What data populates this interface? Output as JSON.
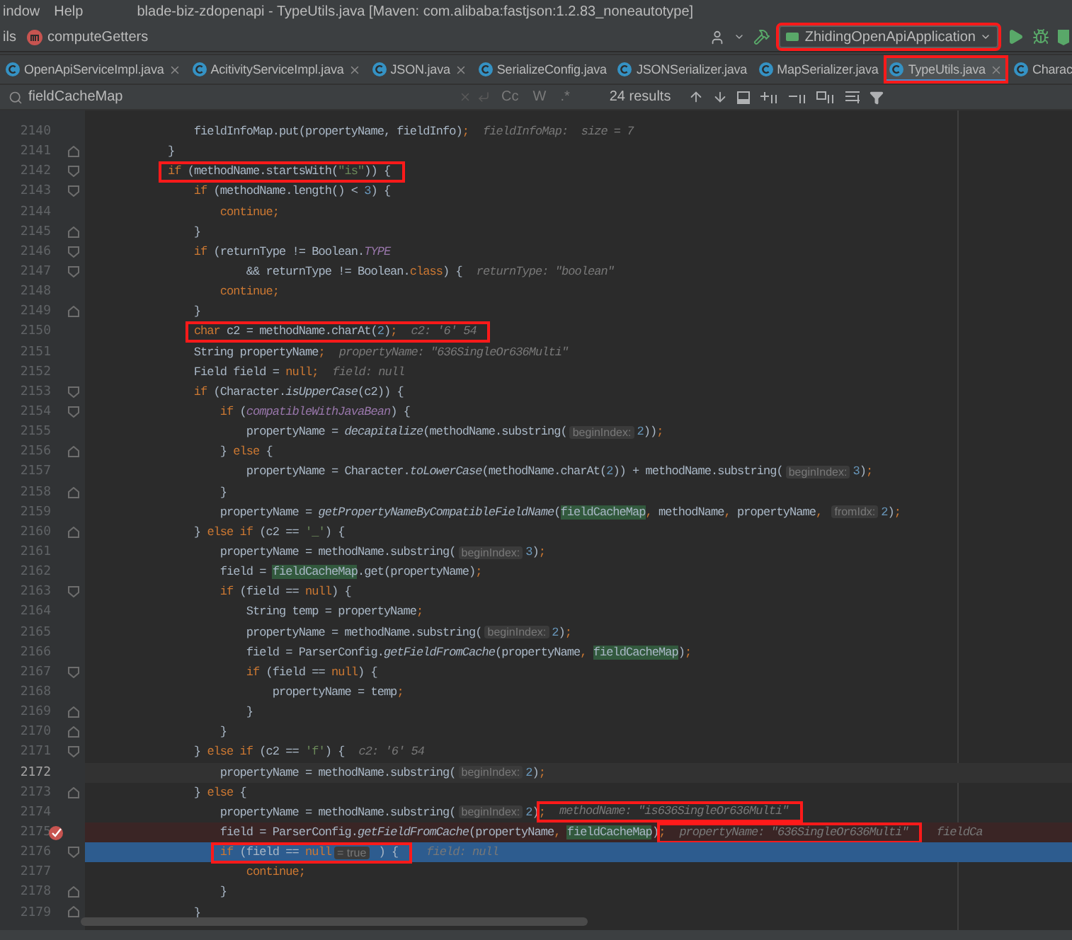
{
  "menu": [
    "indow",
    "Help"
  ],
  "window": {
    "title": "blade-biz-zdopenapi - TypeUtils.java [Maven: com.alibaba:fastjson:1.2.83_noneautotype]"
  },
  "breadcrumbs": [
    {
      "label": "ils",
      "kind": "text"
    },
    {
      "label": "computeGetters",
      "kind": "method"
    }
  ],
  "run_config": {
    "label": "ZhidingOpenApiApplication",
    "boxed": true
  },
  "tabs": [
    {
      "label": "OpenApiServiceImpl.java",
      "selected": false,
      "closable": true,
      "boxed": false
    },
    {
      "label": "AcitivityServiceImpl.java",
      "selected": false,
      "closable": true,
      "boxed": false
    },
    {
      "label": "JSON.java",
      "selected": false,
      "closable": true,
      "boxed": false
    },
    {
      "label": "SerializeConfig.java",
      "selected": false,
      "closable": false,
      "boxed": false
    },
    {
      "label": "JSONSerializer.java",
      "selected": false,
      "closable": false,
      "boxed": false
    },
    {
      "label": "MapSerializer.java",
      "selected": false,
      "closable": false,
      "boxed": false
    },
    {
      "label": "TypeUtils.java",
      "selected": true,
      "closable": true,
      "boxed": true
    },
    {
      "label": "Charac",
      "selected": false,
      "closable": false,
      "boxed": false
    }
  ],
  "search": {
    "value": "fieldCacheMap",
    "options": [
      "Cc",
      "W",
      ".*"
    ],
    "results": "24 results"
  },
  "code": [
    {
      "no": "2140",
      "current": false,
      "breakpoint": false,
      "caret": false,
      "fold_open": false,
      "fold_close": false,
      "tokens": [
        {
          "kind": "t",
          "text": "                fieldInfoMap.put(propertyName, fieldInfo)"
        },
        {
          "kind": "p",
          "text": ";"
        },
        {
          "kind": "d",
          "text": "fieldInfoMap:  size = 7"
        }
      ]
    },
    {
      "no": "2141",
      "current": false,
      "breakpoint": false,
      "caret": false,
      "fold_open": false,
      "fold_close": true,
      "tokens": [
        {
          "kind": "t",
          "text": "            }"
        }
      ]
    },
    {
      "no": "2142",
      "current": false,
      "breakpoint": false,
      "caret": false,
      "fold_open": true,
      "fold_close": false,
      "tokens": [
        {
          "kind": "box",
          "tokens": [
            {
              "kind": "k",
              "text": "            if"
            },
            {
              "kind": "t",
              "text": " (methodName.startsWith("
            },
            {
              "kind": "s",
              "text": "\"is\""
            },
            {
              "kind": "t",
              "text": ")) {"
            }
          ]
        }
      ]
    },
    {
      "no": "2143",
      "current": false,
      "breakpoint": false,
      "caret": false,
      "fold_open": true,
      "fold_close": false,
      "tokens": [
        {
          "kind": "k",
          "text": "                if"
        },
        {
          "kind": "t",
          "text": " (methodName.length() < "
        },
        {
          "kind": "n",
          "text": "3"
        },
        {
          "kind": "t",
          "text": ") {"
        }
      ]
    },
    {
      "no": "2144",
      "current": false,
      "breakpoint": false,
      "caret": false,
      "fold_open": false,
      "fold_close": false,
      "tokens": [
        {
          "kind": "k",
          "text": "                    continue;"
        }
      ]
    },
    {
      "no": "2145",
      "current": false,
      "breakpoint": false,
      "caret": false,
      "fold_open": false,
      "fold_close": true,
      "tokens": [
        {
          "kind": "t",
          "text": "                }"
        }
      ]
    },
    {
      "no": "2146",
      "current": false,
      "breakpoint": false,
      "caret": false,
      "fold_open": true,
      "fold_close": false,
      "tokens": [
        {
          "kind": "k",
          "text": "                if"
        },
        {
          "kind": "t",
          "text": " (returnType != Boolean."
        },
        {
          "kind": "c",
          "text": "TYPE"
        }
      ]
    },
    {
      "no": "2147",
      "current": false,
      "breakpoint": false,
      "caret": false,
      "fold_open": true,
      "fold_close": false,
      "tokens": [
        {
          "kind": "t",
          "text": "                        && returnType != Boolean."
        },
        {
          "kind": "k",
          "text": "class"
        },
        {
          "kind": "t",
          "text": ") {"
        },
        {
          "kind": "d",
          "text": "returnType: \"boolean\""
        }
      ]
    },
    {
      "no": "2148",
      "current": false,
      "breakpoint": false,
      "caret": false,
      "fold_open": false,
      "fold_close": false,
      "tokens": [
        {
          "kind": "k",
          "text": "                    continue;"
        }
      ]
    },
    {
      "no": "2149",
      "current": false,
      "breakpoint": false,
      "caret": false,
      "fold_open": false,
      "fold_close": true,
      "tokens": [
        {
          "kind": "t",
          "text": "                }"
        }
      ]
    },
    {
      "no": "2150",
      "current": false,
      "breakpoint": false,
      "caret": false,
      "fold_open": false,
      "fold_close": false,
      "tokens": [
        {
          "kind": "box",
          "tokens": [
            {
              "kind": "k",
              "text": "                char"
            },
            {
              "kind": "t",
              "text": " c2 = methodName.charAt("
            },
            {
              "kind": "n",
              "text": "2"
            },
            {
              "kind": "t",
              "text": ")"
            },
            {
              "kind": "p",
              "text": ";"
            },
            {
              "kind": "d",
              "text": "c2: '6' 54"
            }
          ]
        }
      ]
    },
    {
      "no": "2151",
      "current": false,
      "breakpoint": false,
      "caret": false,
      "fold_open": false,
      "fold_close": false,
      "tokens": [
        {
          "kind": "t",
          "text": "                String propertyName"
        },
        {
          "kind": "p",
          "text": ";"
        },
        {
          "kind": "d",
          "text": "propertyName: \"636SingleOr636Multi\""
        }
      ]
    },
    {
      "no": "2152",
      "current": false,
      "breakpoint": false,
      "caret": false,
      "fold_open": false,
      "fold_close": false,
      "tokens": [
        {
          "kind": "t",
          "text": "                Field field = "
        },
        {
          "kind": "k",
          "text": "null;"
        },
        {
          "kind": "d",
          "text": "field: null"
        }
      ]
    },
    {
      "no": "2153",
      "current": false,
      "breakpoint": false,
      "caret": false,
      "fold_open": true,
      "fold_close": false,
      "tokens": [
        {
          "kind": "k",
          "text": "                if"
        },
        {
          "kind": "t",
          "text": " (Character."
        },
        {
          "kind": "m",
          "text": "isUpperCase"
        },
        {
          "kind": "t",
          "text": "(c2)) {"
        }
      ]
    },
    {
      "no": "2154",
      "current": false,
      "breakpoint": false,
      "caret": false,
      "fold_open": true,
      "fold_close": false,
      "tokens": [
        {
          "kind": "k",
          "text": "                    if"
        },
        {
          "kind": "t",
          "text": " ("
        },
        {
          "kind": "f",
          "text": "compatibleWithJavaBean"
        },
        {
          "kind": "t",
          "text": ") {"
        }
      ]
    },
    {
      "no": "2155",
      "current": false,
      "breakpoint": false,
      "caret": false,
      "fold_open": false,
      "fold_close": false,
      "tokens": [
        {
          "kind": "t",
          "text": "                        propertyName = "
        },
        {
          "kind": "m",
          "text": "decapitalize"
        },
        {
          "kind": "t",
          "text": "(methodName.substring("
        },
        {
          "kind": "h",
          "text": "beginIndex:"
        },
        {
          "kind": "n",
          "text": "2"
        },
        {
          "kind": "t",
          "text": "))"
        },
        {
          "kind": "p",
          "text": ";"
        }
      ]
    },
    {
      "no": "2156",
      "current": false,
      "breakpoint": false,
      "caret": false,
      "fold_open": false,
      "fold_close": true,
      "tokens": [
        {
          "kind": "t",
          "text": "                    } "
        },
        {
          "kind": "k",
          "text": "else"
        },
        {
          "kind": "t",
          "text": " {"
        }
      ]
    },
    {
      "no": "2157",
      "current": false,
      "breakpoint": false,
      "caret": false,
      "fold_open": false,
      "fold_close": false,
      "tokens": [
        {
          "kind": "t",
          "text": "                        propertyName = Character."
        },
        {
          "kind": "m",
          "text": "toLowerCase"
        },
        {
          "kind": "t",
          "text": "(methodName.charAt("
        },
        {
          "kind": "n",
          "text": "2"
        },
        {
          "kind": "t",
          "text": ")) + methodName.substring("
        },
        {
          "kind": "h",
          "text": "beginIndex:"
        },
        {
          "kind": "n",
          "text": "3"
        },
        {
          "kind": "t",
          "text": ")"
        },
        {
          "kind": "p",
          "text": ";"
        }
      ]
    },
    {
      "no": "2158",
      "current": false,
      "breakpoint": false,
      "caret": false,
      "fold_open": false,
      "fold_close": true,
      "tokens": [
        {
          "kind": "t",
          "text": "                    }"
        }
      ]
    },
    {
      "no": "2159",
      "current": false,
      "breakpoint": false,
      "caret": false,
      "fold_open": false,
      "fold_close": false,
      "tokens": [
        {
          "kind": "t",
          "text": "                    propertyName = "
        },
        {
          "kind": "m",
          "text": "getPropertyNameByCompatibleFieldName"
        },
        {
          "kind": "t",
          "text": "("
        },
        {
          "kind": "g",
          "text": "fieldCacheMap"
        },
        {
          "kind": "p",
          "text": ","
        },
        {
          "kind": "t",
          "text": " methodName"
        },
        {
          "kind": "p",
          "text": ","
        },
        {
          "kind": "t",
          "text": " propertyName"
        },
        {
          "kind": "p",
          "text": ", "
        },
        {
          "kind": "h",
          "text": "fromIdx:"
        },
        {
          "kind": "n",
          "text": "2"
        },
        {
          "kind": "t",
          "text": ")"
        },
        {
          "kind": "p",
          "text": ";"
        }
      ]
    },
    {
      "no": "2160",
      "current": false,
      "breakpoint": false,
      "caret": false,
      "fold_open": false,
      "fold_close": true,
      "tokens": [
        {
          "kind": "t",
          "text": "                } "
        },
        {
          "kind": "k",
          "text": "else if"
        },
        {
          "kind": "t",
          "text": " (c2 == "
        },
        {
          "kind": "s",
          "text": "'_'"
        },
        {
          "kind": "t",
          "text": ") {"
        }
      ]
    },
    {
      "no": "2161",
      "current": false,
      "breakpoint": false,
      "caret": false,
      "fold_open": false,
      "fold_close": false,
      "tokens": [
        {
          "kind": "t",
          "text": "                    propertyName = methodName.substring("
        },
        {
          "kind": "h",
          "text": "beginIndex:"
        },
        {
          "kind": "n",
          "text": "3"
        },
        {
          "kind": "t",
          "text": ")"
        },
        {
          "kind": "p",
          "text": ";"
        }
      ]
    },
    {
      "no": "2162",
      "current": false,
      "breakpoint": false,
      "caret": false,
      "fold_open": false,
      "fold_close": false,
      "tokens": [
        {
          "kind": "t",
          "text": "                    field = "
        },
        {
          "kind": "g",
          "text": "fieldCacheMap"
        },
        {
          "kind": "t",
          "text": ".get(propertyName)"
        },
        {
          "kind": "p",
          "text": ";"
        }
      ]
    },
    {
      "no": "2163",
      "current": false,
      "breakpoint": false,
      "caret": false,
      "fold_open": true,
      "fold_close": false,
      "tokens": [
        {
          "kind": "k",
          "text": "                    if"
        },
        {
          "kind": "t",
          "text": " (field == "
        },
        {
          "kind": "k",
          "text": "null"
        },
        {
          "kind": "t",
          "text": ") {"
        }
      ]
    },
    {
      "no": "2164",
      "current": false,
      "breakpoint": false,
      "caret": false,
      "fold_open": false,
      "fold_close": false,
      "tokens": [
        {
          "kind": "t",
          "text": "                        String temp = propertyName"
        },
        {
          "kind": "p",
          "text": ";"
        }
      ]
    },
    {
      "no": "2165",
      "current": false,
      "breakpoint": false,
      "caret": false,
      "fold_open": false,
      "fold_close": false,
      "tokens": [
        {
          "kind": "t",
          "text": "                        propertyName = methodName.substring("
        },
        {
          "kind": "h",
          "text": "beginIndex:"
        },
        {
          "kind": "n",
          "text": "2"
        },
        {
          "kind": "t",
          "text": ")"
        },
        {
          "kind": "p",
          "text": ";"
        }
      ]
    },
    {
      "no": "2166",
      "current": false,
      "breakpoint": false,
      "caret": false,
      "fold_open": false,
      "fold_close": false,
      "tokens": [
        {
          "kind": "t",
          "text": "                        field = ParserConfig."
        },
        {
          "kind": "m",
          "text": "getFieldFromCache"
        },
        {
          "kind": "t",
          "text": "(propertyName"
        },
        {
          "kind": "p",
          "text": ", "
        },
        {
          "kind": "g",
          "text": "fieldCacheMap"
        },
        {
          "kind": "t",
          "text": ")"
        },
        {
          "kind": "p",
          "text": ";"
        }
      ]
    },
    {
      "no": "2167",
      "current": false,
      "breakpoint": false,
      "caret": false,
      "fold_open": true,
      "fold_close": false,
      "tokens": [
        {
          "kind": "k",
          "text": "                        if"
        },
        {
          "kind": "t",
          "text": " (field == "
        },
        {
          "kind": "k",
          "text": "null"
        },
        {
          "kind": "t",
          "text": ") {"
        }
      ]
    },
    {
      "no": "2168",
      "current": false,
      "breakpoint": false,
      "caret": false,
      "fold_open": false,
      "fold_close": false,
      "tokens": [
        {
          "kind": "t",
          "text": "                            propertyName = temp"
        },
        {
          "kind": "p",
          "text": ";"
        }
      ]
    },
    {
      "no": "2169",
      "current": false,
      "breakpoint": false,
      "caret": false,
      "fold_open": false,
      "fold_close": true,
      "tokens": [
        {
          "kind": "t",
          "text": "                        }"
        }
      ]
    },
    {
      "no": "2170",
      "current": false,
      "breakpoint": false,
      "caret": false,
      "fold_open": false,
      "fold_close": true,
      "tokens": [
        {
          "kind": "t",
          "text": "                    }"
        }
      ]
    },
    {
      "no": "2171",
      "current": false,
      "breakpoint": false,
      "caret": false,
      "fold_open": true,
      "fold_close": false,
      "tokens": [
        {
          "kind": "t",
          "text": "                } "
        },
        {
          "kind": "k",
          "text": "else if"
        },
        {
          "kind": "t",
          "text": " (c2 == "
        },
        {
          "kind": "s",
          "text": "'f'"
        },
        {
          "kind": "t",
          "text": ") {"
        },
        {
          "kind": "d",
          "text": "c2: '6' 54"
        }
      ]
    },
    {
      "no": "2172",
      "current": false,
      "breakpoint": false,
      "caret": true,
      "fold_open": false,
      "fold_close": false,
      "tokens": [
        {
          "kind": "t",
          "text": "                    propertyName = methodName.substring("
        },
        {
          "kind": "h",
          "text": "beginIndex:"
        },
        {
          "kind": "n",
          "text": "2"
        },
        {
          "kind": "t",
          "text": ")"
        },
        {
          "kind": "p",
          "text": ";"
        }
      ]
    },
    {
      "no": "2173",
      "current": false,
      "breakpoint": false,
      "caret": false,
      "fold_open": false,
      "fold_close": true,
      "tokens": [
        {
          "kind": "t",
          "text": "                } "
        },
        {
          "kind": "k",
          "text": "else"
        },
        {
          "kind": "t",
          "text": " {"
        }
      ]
    },
    {
      "no": "2174",
      "current": false,
      "breakpoint": false,
      "caret": false,
      "fold_open": false,
      "fold_close": false,
      "tokens": [
        {
          "kind": "t",
          "text": "                    propertyName = methodName.substring("
        },
        {
          "kind": "h",
          "text": "beginIndex:"
        },
        {
          "kind": "n",
          "text": "2"
        },
        {
          "kind": "t",
          "text": ")"
        },
        {
          "kind": "p",
          "text": ";"
        },
        {
          "kind": "box",
          "tokens": [
            {
              "kind": "d",
              "text": "methodName: \"is636SingleOr636Multi\""
            }
          ]
        }
      ]
    },
    {
      "no": "2175",
      "current": false,
      "breakpoint": true,
      "caret": false,
      "fold_open": false,
      "fold_close": false,
      "tokens": [
        {
          "kind": "t",
          "text": "                    field = ParserConfig."
        },
        {
          "kind": "m",
          "text": "getFieldFromCache"
        },
        {
          "kind": "t",
          "text": "(propertyName"
        },
        {
          "kind": "p",
          "text": ", "
        },
        {
          "kind": "g",
          "text": "fieldCacheMap"
        },
        {
          "kind": "t",
          "text": ")"
        },
        {
          "kind": "p",
          "text": ";"
        },
        {
          "kind": "box",
          "tokens": [
            {
              "kind": "d",
              "text": "propertyName: \"636SingleOr636Multi\""
            }
          ]
        },
        {
          "kind": "d",
          "text": "fieldCa"
        }
      ]
    },
    {
      "no": "2176",
      "current": true,
      "breakpoint": false,
      "caret": false,
      "fold_open": true,
      "fold_close": false,
      "tokens": [
        {
          "kind": "box",
          "tokens": [
            {
              "kind": "k",
              "text": "                    if"
            },
            {
              "kind": "t",
              "text": " (field == "
            },
            {
              "kind": "k",
              "text": "null"
            },
            {
              "kind": "h",
              "text": "= true"
            },
            {
              "kind": "t",
              "text": " ) {"
            }
          ]
        },
        {
          "kind": "d",
          "text": "field: null"
        }
      ]
    },
    {
      "no": "2177",
      "current": false,
      "breakpoint": false,
      "caret": false,
      "fold_open": false,
      "fold_close": false,
      "tokens": [
        {
          "kind": "k",
          "text": "                        continue;"
        }
      ]
    },
    {
      "no": "2178",
      "current": false,
      "breakpoint": false,
      "caret": false,
      "fold_open": false,
      "fold_close": true,
      "tokens": [
        {
          "kind": "t",
          "text": "                    }"
        }
      ]
    },
    {
      "no": "2179",
      "current": false,
      "breakpoint": false,
      "caret": false,
      "fold_open": false,
      "fold_close": true,
      "tokens": [
        {
          "kind": "t",
          "text": "                }"
        }
      ]
    }
  ]
}
